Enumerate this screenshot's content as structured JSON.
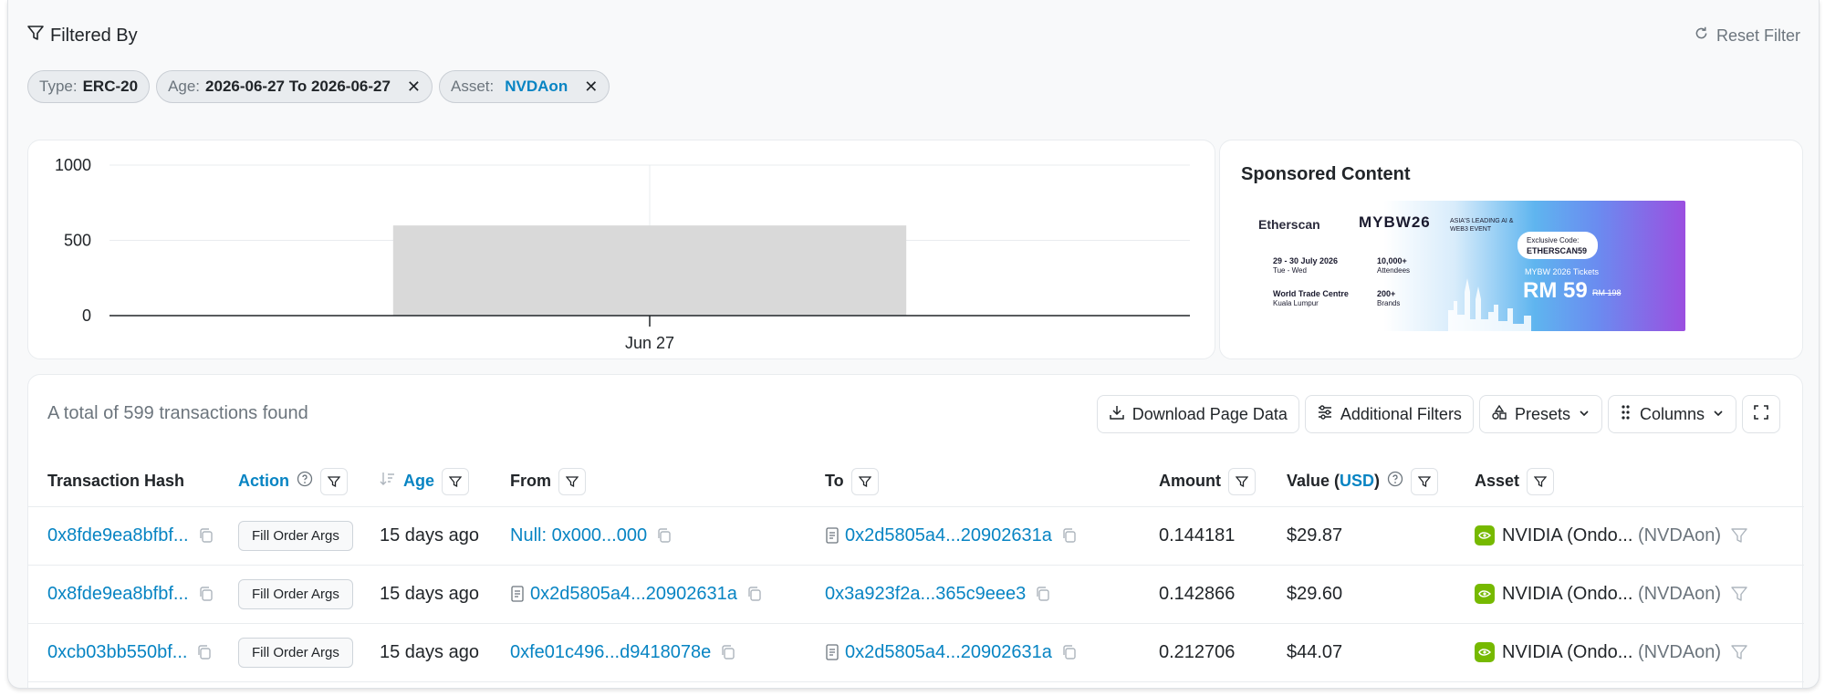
{
  "filter_bar": {
    "title": "Filtered By",
    "reset_label": "Reset Filter"
  },
  "chips": [
    {
      "key": "Type:",
      "value": "ERC-20"
    },
    {
      "key": "Age:",
      "value": "2026-06-27 To 2026-06-27"
    },
    {
      "key": "Asset:",
      "value": "NVDAon"
    }
  ],
  "chart_data": {
    "type": "bar",
    "categories": [
      "Jun 27"
    ],
    "values": [
      599
    ],
    "ylim": [
      0,
      1000
    ],
    "yticks": [
      "1000",
      "500",
      "0"
    ],
    "grid": true,
    "bar_color": "#d9d9d9"
  },
  "sponsor": {
    "title": "Sponsored Content",
    "banner": {
      "brand": "Etherscan",
      "event": "MYBW26",
      "tagline": "ASIA'S LEADING AI & WEB3 EVENT",
      "dates": "29 - 30 July 2026",
      "days": "Tue - Wed",
      "venue": "World Trade Centre",
      "city": "Kuala Lumpur",
      "attendees": "10,000+",
      "attendees_label": "Attendees",
      "brands": "200+",
      "brands_label": "Brands",
      "code_label": "Exclusive Code:",
      "code": "ETHERSCAN59",
      "tickets": "MYBW 2026 Tickets",
      "price": "RM 59",
      "old_price": "RM 198"
    }
  },
  "table": {
    "summary": "A total of 599 transactions found",
    "toolbar": {
      "download": "Download Page Data",
      "additional": "Additional Filters",
      "presets": "Presets",
      "columns": "Columns"
    },
    "headers": {
      "hash": "Transaction Hash",
      "action": "Action",
      "age": "Age",
      "from": "From",
      "to": "To",
      "amount": "Amount",
      "value_prefix": "Value (",
      "value_currency": "USD",
      "value_suffix": ")",
      "asset": "Asset"
    },
    "rows": [
      {
        "hash": "0x8fde9ea8bfbf...",
        "action": "Fill Order Args",
        "age": "15 days ago",
        "from": "Null: 0x000...000",
        "to": "0x2d5805a4...20902631a",
        "amount": "0.144181",
        "value": "$29.87",
        "asset": "NVIDIA (Ondo...",
        "symbol": "(NVDAon)"
      },
      {
        "hash": "0x8fde9ea8bfbf...",
        "action": "Fill Order Args",
        "age": "15 days ago",
        "from": "0x2d5805a4...20902631a",
        "to": "0x3a923f2a...365c9eee3",
        "amount": "0.142866",
        "value": "$29.60",
        "asset": "NVIDIA (Ondo...",
        "symbol": "(NVDAon)"
      },
      {
        "hash": "0xcb03bb550bf...",
        "action": "Fill Order Args",
        "age": "15 days ago",
        "from": "0xfe01c496...d9418078e",
        "to": "0x2d5805a4...20902631a",
        "amount": "0.212706",
        "value": "$44.07",
        "asset": "NVIDIA (Ondo...",
        "symbol": "(NVDAon)"
      }
    ]
  }
}
